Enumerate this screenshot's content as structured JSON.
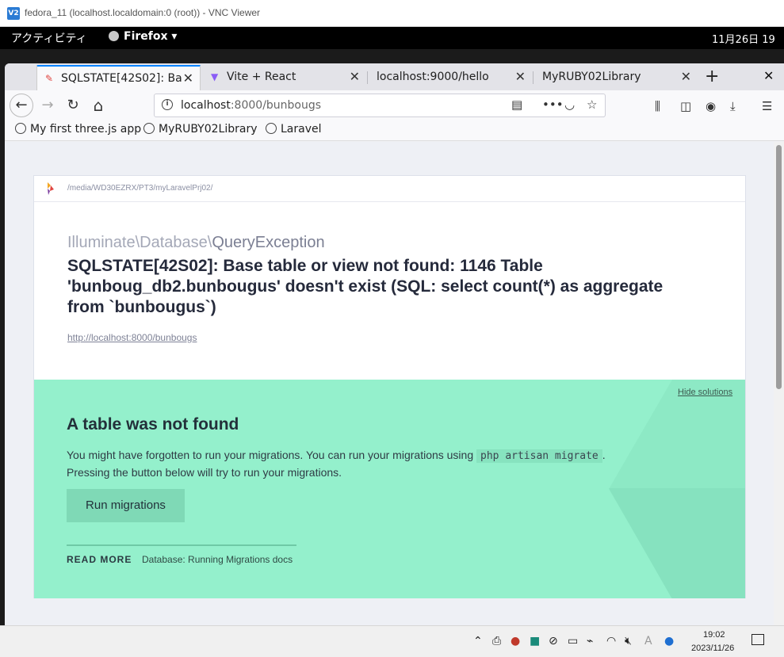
{
  "vnc": {
    "title": "fedora_11 (localhost.localdomain:0 (root)) - VNC Viewer",
    "logo_text": "V2"
  },
  "gnome": {
    "activities": "アクティビティ",
    "app_name": "Firefox ▾",
    "clock": "11月26日 19"
  },
  "tabs": [
    {
      "label": "SQLSTATE[42S02]: Ba",
      "close": "✕"
    },
    {
      "label": "Vite + React",
      "close": "✕"
    },
    {
      "label": "localhost:9000/hello",
      "close": "✕"
    },
    {
      "label": "MyRUBY02Library",
      "close": "✕"
    }
  ],
  "tabbar": {
    "new_tab": "+",
    "close_window": "✕"
  },
  "nav": {
    "back": "←",
    "forward": "→",
    "reload": "↻",
    "home": "⌂",
    "url_host": "localhost",
    "url_rest": ":8000/bunbougs",
    "info": "i"
  },
  "bookmarks": [
    {
      "label": "My first three.js app"
    },
    {
      "label": "MyRUBY02Library"
    },
    {
      "label": "Laravel"
    }
  ],
  "error": {
    "path": "/media/WD30EZRX/PT3/myLaravelPrj02/",
    "class_prefix": "Illuminate\\Database\\",
    "class_name": "QueryException",
    "message": "SQLSTATE[42S02]: Base table or view not found: 1146 Table 'bunboug_db2.bunbougus' doesn't exist (SQL: select count(*) as aggregate from `bunbougus`)",
    "url": "http://localhost:8000/bunbougs"
  },
  "solution": {
    "hide_label": "Hide solutions",
    "title": "A table was not found",
    "desc_before": "You might have forgotten to run your migrations. You can run your migrations using ",
    "desc_code": "php artisan migrate",
    "desc_after": ". Pressing the button below will try to run your migrations.",
    "button": "Run migrations",
    "read_more": "READ MORE",
    "doc_link": "Database: Running Migrations docs"
  },
  "taskbar": {
    "time": "19:02",
    "date": "2023/11/26",
    "ime": "A"
  },
  "colors": {
    "solution_bg": "#94f0cc",
    "accent": "#0a84ff"
  }
}
